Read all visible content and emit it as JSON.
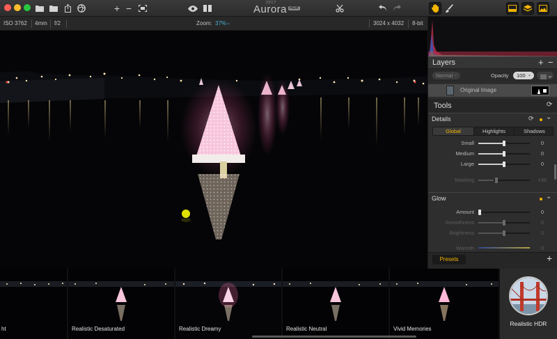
{
  "toolbar": {
    "logo_word": "Aurora",
    "logo_year": "2017",
    "logo_badge": "HDR"
  },
  "info": {
    "iso": "ISO 3762",
    "focal": "4mm",
    "aperture": "f/2",
    "zoom_label": "Zoom:",
    "zoom_value": "37%",
    "dimensions": "3024 x 4032",
    "bitdepth": "8-bit"
  },
  "layers": {
    "title": "Layers",
    "blend_mode": "Normal",
    "opacity_label": "Opacity",
    "opacity_value": "100",
    "layer_name": "Original Image"
  },
  "tools": {
    "title": "Tools",
    "details": {
      "title": "Details",
      "tabs": [
        "Global",
        "Highlights",
        "Shadows"
      ],
      "sliders": [
        {
          "label": "Small",
          "value": "0",
          "level": 0.5
        },
        {
          "label": "Medium",
          "value": "0",
          "level": 0.5
        },
        {
          "label": "Large",
          "value": "0",
          "level": 0.5
        }
      ],
      "masking": {
        "label": "Masking",
        "value": "+35",
        "level": 0.3
      }
    },
    "glow": {
      "title": "Glow",
      "sliders": [
        {
          "label": "Amount",
          "value": "0",
          "level": 0.0
        },
        {
          "label": "Smoothness",
          "value": "0",
          "level": 0.5
        },
        {
          "label": "Brightness",
          "value": "0",
          "level": 0.5
        },
        {
          "label": "Warmth",
          "value": "0",
          "level": 0.5
        }
      ]
    }
  },
  "presets": {
    "tab_label": "Presets",
    "items": [
      {
        "label": "ht"
      },
      {
        "label": "Realistic Desaturated"
      },
      {
        "label": "Realistic Dreamy"
      },
      {
        "label": "Realistic Neutral"
      },
      {
        "label": "Vivid Memories"
      }
    ],
    "featured_label": "Realistic HDR"
  },
  "colors": {
    "accent_yellow": "#f4b400",
    "zoom_blue": "#4ab3d8",
    "traffic_red": "#ff5f57",
    "traffic_yellow": "#febc2e",
    "traffic_green": "#28c840"
  }
}
